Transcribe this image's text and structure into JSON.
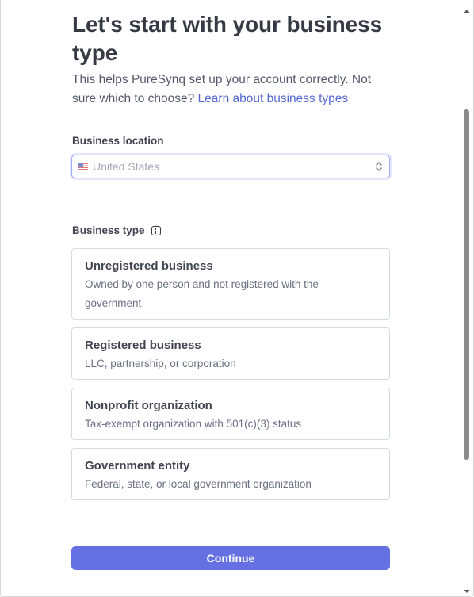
{
  "header": {
    "title": "Let's start with your business type",
    "subtitle_text": "This helps PureSynq set up your account correctly. Not sure which to choose?",
    "subtitle_link": "Learn about business types"
  },
  "location": {
    "label": "Business location",
    "selected": "United States",
    "flag_icon": "us-flag-icon"
  },
  "business_type": {
    "label": "Business type",
    "options": [
      {
        "title": "Unregistered business",
        "description": "Owned by one person and not registered with the government"
      },
      {
        "title": "Registered business",
        "description": "LLC, partnership, or corporation"
      },
      {
        "title": "Nonprofit organization",
        "description": "Tax-exempt organization with 501(c)(3) status"
      },
      {
        "title": "Government entity",
        "description": "Federal, state, or local government organization"
      }
    ]
  },
  "actions": {
    "continue_label": "Continue"
  },
  "colors": {
    "primary": "#6570e3",
    "link": "#5469d4",
    "focus_ring": "#a3acf0",
    "text": "#353a44"
  }
}
